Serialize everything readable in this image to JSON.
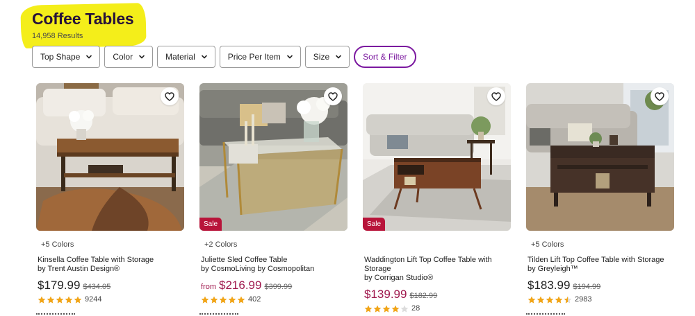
{
  "page": {
    "title": "Coffee Tables",
    "results": "14,958 Results",
    "highlight_color": "#f4ee1a",
    "accent_color": "#7b189f",
    "sale_color": "#a0194e"
  },
  "filters": {
    "items": [
      "Top Shape",
      "Color",
      "Material",
      "Price Per Item",
      "Size"
    ],
    "sort_filter": "Sort & Filter"
  },
  "products": [
    {
      "colors": "+5 Colors",
      "name": "Kinsella Coffee Table with Storage",
      "by": "by Trent Austin Design®",
      "from": "",
      "price": "$179.99",
      "was": "$434.05",
      "rating": 5,
      "reviews": "9244",
      "sale": false,
      "favorite_icon": "heart-icon"
    },
    {
      "colors": "+2 Colors",
      "name": "Juliette Sled Coffee Table",
      "by": "by CosmoLiving by Cosmopolitan",
      "from": "from",
      "price": "$216.99",
      "was": "$399.99",
      "rating": 5,
      "reviews": "402",
      "sale": true,
      "sale_label": "Sale",
      "favorite_icon": "heart-icon"
    },
    {
      "colors": "",
      "name": "Waddington Lift Top Coffee Table with Storage",
      "by": "by Corrigan Studio®",
      "from": "",
      "price": "$139.99",
      "was": "$182.99",
      "rating": 4,
      "reviews": "28",
      "sale": true,
      "sale_label": "Sale",
      "favorite_icon": "heart-icon"
    },
    {
      "colors": "+5 Colors",
      "name": "Tilden Lift Top Coffee Table with Storage",
      "by": "by Greyleigh™",
      "from": "",
      "price": "$183.99",
      "was": "$194.99",
      "rating": 4.5,
      "reviews": "2983",
      "sale": false,
      "favorite_icon": "heart-icon"
    }
  ]
}
